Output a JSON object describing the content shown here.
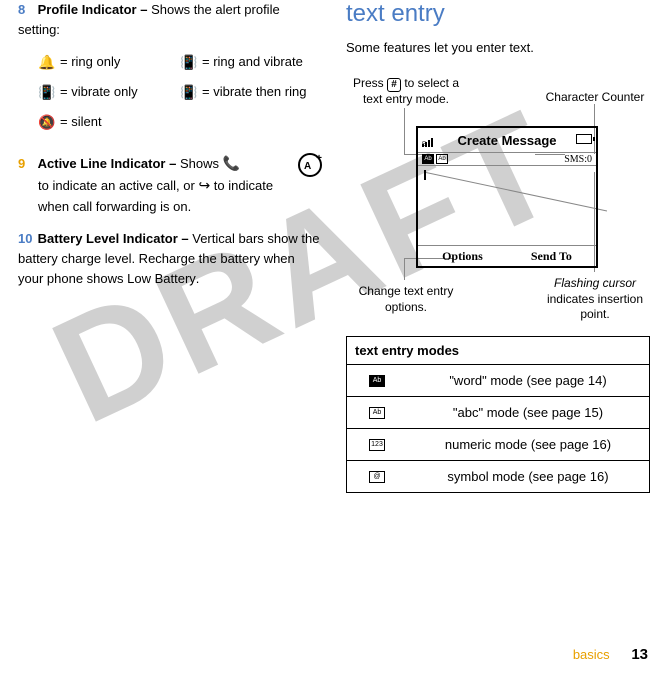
{
  "left": {
    "item8": {
      "num": "8",
      "title": "Profile Indicator –",
      "desc": "Shows the alert profile setting:",
      "icons": [
        {
          "glyph": "🔔",
          "label": "= ring only"
        },
        {
          "glyph": "📳",
          "label": "= ring and vibrate"
        },
        {
          "glyph": "📳",
          "label": "= vibrate only"
        },
        {
          "glyph": "📳",
          "label": "= vibrate then ring"
        },
        {
          "glyph": "🔕",
          "label": "= silent"
        }
      ]
    },
    "item9": {
      "num": "9",
      "title": "Active Line Indicator –",
      "desc1": "Shows",
      "desc2": "to indicate an active call, or",
      "desc3": "to indicate when call forwarding is on.",
      "call_glyph": "📞",
      "fwd_glyph": "↪"
    },
    "item10": {
      "num": "10",
      "title": "Battery Level Indicator –",
      "desc": "Vertical bars show the battery charge level. Recharge the battery when your phone shows",
      "low": "Low Battery"
    }
  },
  "right": {
    "heading": "text entry",
    "sub": "Some features let you enter text.",
    "ann": {
      "press1": "Press",
      "press_key": "#",
      "press2": "to select a text entry mode.",
      "counter": "Character Counter",
      "change": "Change text entry options.",
      "cursor_it": "Flashing cursor",
      "cursor_rest": "indicates insertion point."
    },
    "screen": {
      "title": "Create Message",
      "mode1": "Ab",
      "mode2": "Ab",
      "sms": "SMS:0",
      "left_soft": "Options",
      "right_soft": "Send To"
    },
    "table": {
      "head": "text entry modes",
      "rows": [
        {
          "icon": "Ab",
          "filled": true,
          "text": "\"word\" mode (see page 14)"
        },
        {
          "icon": "Ab",
          "filled": false,
          "text": "\"abc\" mode (see page 15)"
        },
        {
          "icon": "123",
          "filled": false,
          "text": "numeric mode (see page 16)"
        },
        {
          "icon": "@",
          "filled": false,
          "text": "symbol mode (see page 16)"
        }
      ]
    }
  },
  "footer": {
    "section": "basics",
    "page": "13"
  },
  "watermark": "DRAFT"
}
